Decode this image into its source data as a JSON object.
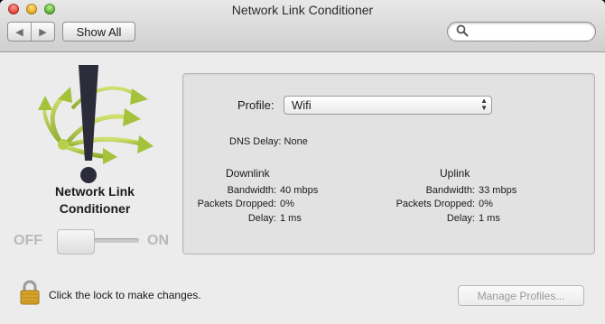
{
  "window": {
    "title": "Network Link Conditioner"
  },
  "toolbar": {
    "back_glyph": "◀",
    "forward_glyph": "▶",
    "show_all_label": "Show All",
    "search_placeholder": "",
    "search_value": ""
  },
  "app": {
    "name_line1": "Network Link",
    "name_line2": "Conditioner"
  },
  "toggle": {
    "off_label": "OFF",
    "on_label": "ON",
    "state": "off"
  },
  "profile": {
    "label": "Profile:",
    "selected": "Wifi"
  },
  "dns": {
    "label": "DNS Delay:",
    "value": "None"
  },
  "downlink": {
    "title": "Downlink",
    "bandwidth_label": "Bandwidth:",
    "bandwidth": "40 mbps",
    "packets_label": "Packets Dropped:",
    "packets": "0%",
    "delay_label": "Delay:",
    "delay": "1 ms"
  },
  "uplink": {
    "title": "Uplink",
    "bandwidth_label": "Bandwidth:",
    "bandwidth": "33 mbps",
    "packets_label": "Packets Dropped:",
    "packets": "0%",
    "delay_label": "Delay:",
    "delay": "1 ms"
  },
  "footer": {
    "lock_text": "Click the lock to make changes.",
    "manage_label": "Manage Profiles..."
  },
  "colors": {
    "accent_green": "#9fbf2f",
    "logo_dark": "#2b2b3a",
    "disabled_text": "#9a9a9a"
  },
  "icons": [
    "back-arrow-icon",
    "forward-arrow-icon",
    "search-icon",
    "network-link-conditioner-logo-icon",
    "lock-icon",
    "popup-arrows-icon"
  ]
}
